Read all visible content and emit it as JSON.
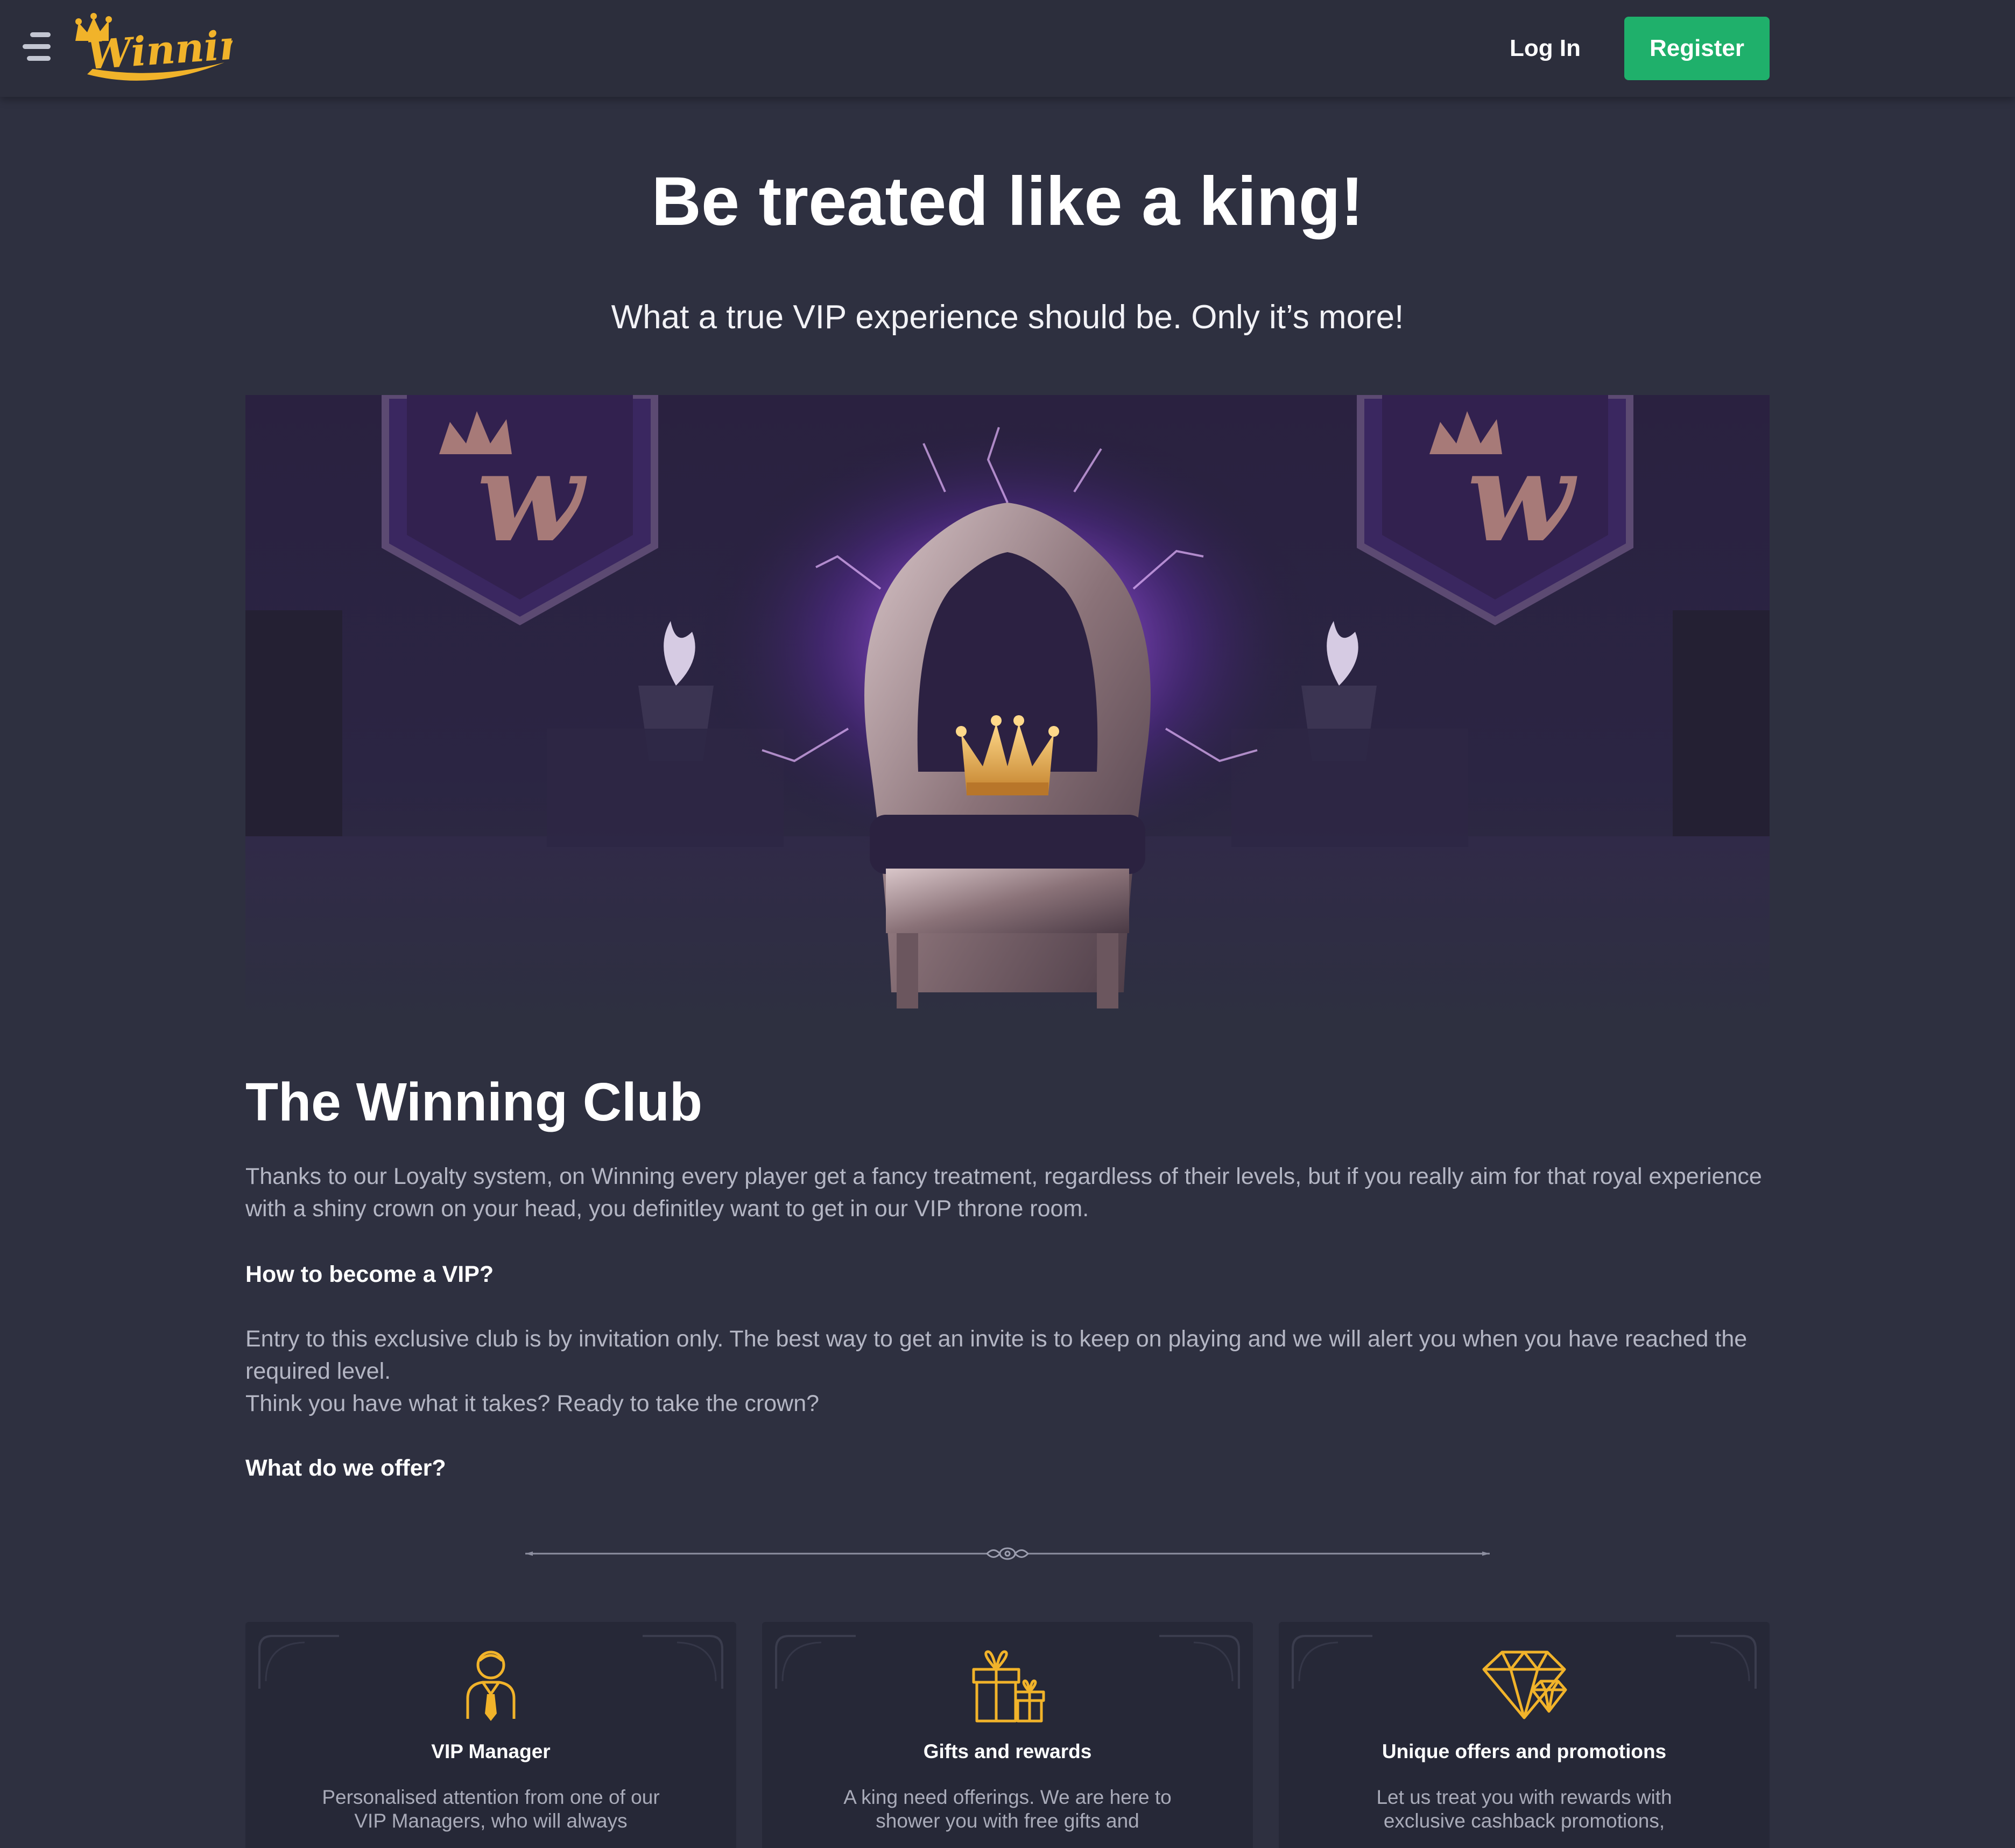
{
  "header": {
    "logo_text": "Winning",
    "login_label": "Log In",
    "register_label": "Register"
  },
  "hero": {
    "title": "Be treated like a king!",
    "subtitle": "What a true VIP experience should be. Only it’s more!"
  },
  "club": {
    "title": "The Winning Club",
    "intro": "Thanks to our Loyalty system, on Winning every player get a fancy treatment, regardless of their levels, but if you really aim for that royal experience with a shiny crown on your head, you definitley want to get in our VIP throne room.",
    "how_heading": "How to become a VIP?",
    "how_text_1": "Entry to this exclusive club is by invitation only. The best way to get an invite is to keep on playing and we will alert you when you have reached the required level.",
    "how_text_2": "Think you have what it takes? Ready to take the crown?",
    "offer_heading": "What do we offer?"
  },
  "features": [
    {
      "icon": "vip-manager-icon",
      "title": "VIP Manager",
      "text": "Personalised attention from one of our VIP Managers, who will always"
    },
    {
      "icon": "gift-icon",
      "title": "Gifts and rewards",
      "text": "A king need offerings. We are here to shower you with free gifts and"
    },
    {
      "icon": "diamond-icon",
      "title": "Unique offers and promotions",
      "text": "Let us treat you with rewards with exclusive cashback promotions,"
    }
  ],
  "colors": {
    "page_background": "#2e3040",
    "header_background": "#2c2e3c",
    "register_button": "#1fb06b",
    "gold_accent": "#f1b32a",
    "card_background": "#262837",
    "body_text": "#b4b6c4"
  }
}
